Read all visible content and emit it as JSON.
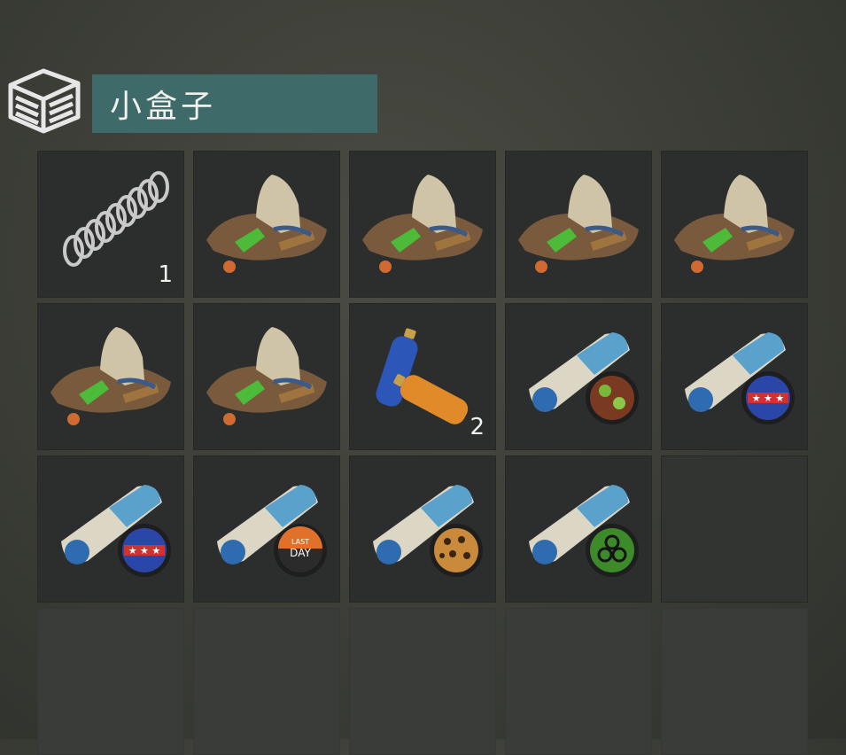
{
  "container": {
    "title": "小盒子",
    "icon": "box-icon"
  },
  "slots": [
    {
      "item": "spring-icon",
      "count": "1"
    },
    {
      "item": "scrap-pile-icon",
      "count": ""
    },
    {
      "item": "scrap-pile-icon",
      "count": ""
    },
    {
      "item": "scrap-pile-icon",
      "count": ""
    },
    {
      "item": "scrap-pile-icon",
      "count": ""
    },
    {
      "item": "scrap-pile-icon",
      "count": ""
    },
    {
      "item": "scrap-pile-icon",
      "count": ""
    },
    {
      "item": "battery-icon",
      "count": "2"
    },
    {
      "item": "magazine-flowers-icon",
      "count": ""
    },
    {
      "item": "magazine-stars-icon",
      "count": ""
    },
    {
      "item": "magazine-stars-icon",
      "count": ""
    },
    {
      "item": "magazine-lastday-icon",
      "count": ""
    },
    {
      "item": "magazine-leopard-icon",
      "count": ""
    },
    {
      "item": "magazine-biohazard-icon",
      "count": ""
    },
    {
      "item": "",
      "count": ""
    }
  ],
  "colors": {
    "title_bar": "#3e6a6a",
    "slot": "#2b2e2c",
    "background": "#3d3f38"
  }
}
